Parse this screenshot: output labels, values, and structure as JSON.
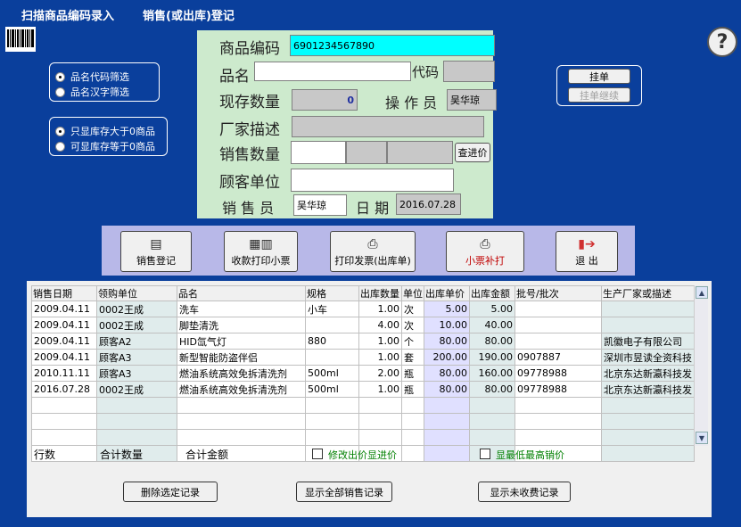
{
  "title": {
    "left": "扫描商品编码录入",
    "right": "销售(或出库)登记"
  },
  "filters": {
    "group1": [
      {
        "label": "品名代码筛选",
        "checked": true
      },
      {
        "label": "品名汉字筛选",
        "checked": false
      }
    ],
    "group2": [
      {
        "label": "只显库存大于0商品",
        "checked": true
      },
      {
        "label": "可显库存等于0商品",
        "checked": false
      }
    ]
  },
  "form": {
    "code_label": "商品编码",
    "code_value": "6901234567890",
    "name_label": "品名",
    "name_value": "",
    "code2_label": "代码",
    "code2_value": "",
    "stock_label": "现存数量",
    "stock_value": "0",
    "operator_label": "操 作 员",
    "operator_value": "吴华琼",
    "maker_label": "厂家描述",
    "maker_value": "",
    "qty_label": "销售数量",
    "qty_value": "",
    "cost_button": "查进价",
    "customer_label": "顾客单位",
    "customer_value": "",
    "seller_label": "销 售 员",
    "seller_value": "吴华琼",
    "date_label": "日 期",
    "date_value": "2016.07.28"
  },
  "hold": {
    "hold_button": "挂单",
    "resume_button": "挂单继续"
  },
  "toolbar": [
    {
      "label": "销售登记",
      "icon": "register-icon"
    },
    {
      "label": "收款打印小票",
      "icon": "calculator-icon"
    },
    {
      "label": "打印发票(出库单)",
      "icon": "printer-icon"
    },
    {
      "label": "小票补打",
      "icon": "printer-icon"
    },
    {
      "label": "退 出",
      "icon": "exit-icon"
    }
  ],
  "table": {
    "headers": [
      "销售日期",
      "领购单位",
      "品名",
      "规格",
      "出库数量",
      "单位",
      "出库单价",
      "出库金额",
      "批号/批次",
      "生产厂家或描述"
    ],
    "rows": [
      [
        "2009.04.11",
        "0002王成",
        "洗车",
        "小车",
        "1.00",
        "次",
        "5.00",
        "5.00",
        "",
        ""
      ],
      [
        "2009.04.11",
        "0002王成",
        "脚垫清洗",
        "",
        "4.00",
        "次",
        "10.00",
        "40.00",
        "",
        ""
      ],
      [
        "2009.04.11",
        "顾客A2",
        "HID氙气灯",
        "880",
        "1.00",
        "个",
        "80.00",
        "80.00",
        "",
        "凯徽电子有限公司"
      ],
      [
        "2009.04.11",
        "顾客A3",
        "新型智能防盗伴侣",
        "",
        "1.00",
        "套",
        "200.00",
        "190.00",
        "0907887",
        "深圳市昱读全资科技"
      ],
      [
        "2010.11.11",
        "顾客A3",
        "燃油系统高效免拆清洗剂",
        "500ml",
        "2.00",
        "瓶",
        "80.00",
        "160.00",
        "09778988",
        "北京东达新瀛科技发"
      ],
      [
        "2016.07.28",
        "0002王成",
        "燃油系统高效免拆清洗剂",
        "500ml",
        "1.00",
        "瓶",
        "80.00",
        "80.00",
        "09778988",
        "北京东达新瀛科技发"
      ]
    ],
    "empty_rows": 4
  },
  "summary": {
    "rows_label": "行数",
    "total_qty_label": "合计数量",
    "total_amount_label": "合计金额",
    "modify_price_label": "修改出价显进价",
    "minmax_label": "显最低最高销价"
  },
  "actions": {
    "delete_button": "删除选定记录",
    "show_all_button": "显示全部销售记录",
    "show_unpaid_button": "显示未收费记录"
  }
}
